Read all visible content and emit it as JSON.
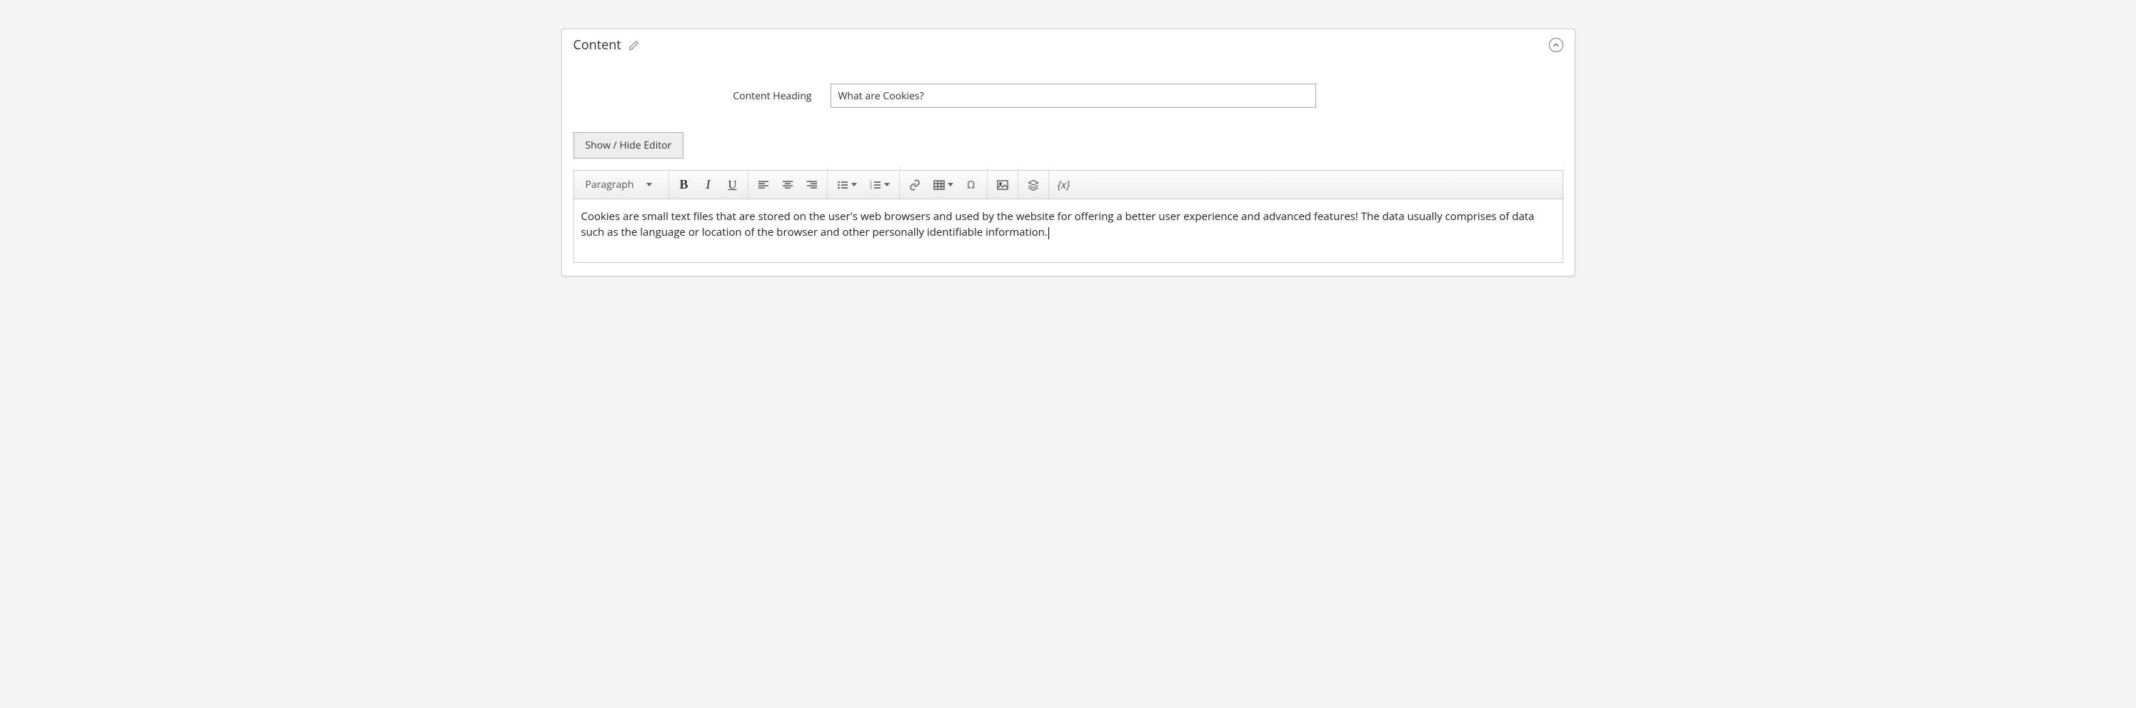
{
  "panel": {
    "title": "Content"
  },
  "field": {
    "label": "Content Heading",
    "value": "What are Cookies?"
  },
  "buttons": {
    "toggle_editor": "Show / Hide Editor"
  },
  "toolbar": {
    "format": "Paragraph",
    "variable": "{x}"
  },
  "content": {
    "body": "Cookies are small text files that are stored on the user's web browsers and used by the website for offering a better user experience and advanced features! The data usually comprises of data such as the language or location of the browser and other personally identifiable information."
  }
}
